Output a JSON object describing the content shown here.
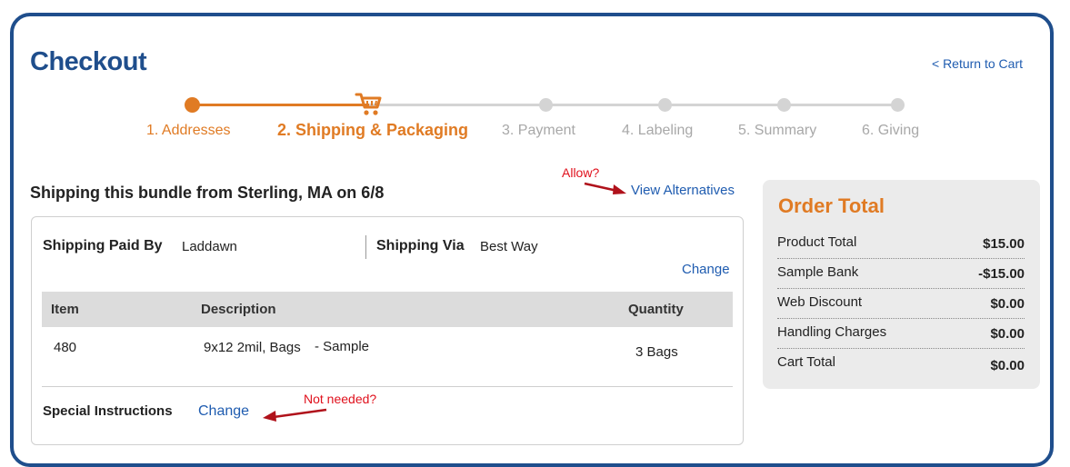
{
  "header": {
    "title": "Checkout",
    "return_link": "< Return to Cart"
  },
  "steps": [
    {
      "label": "1. Addresses",
      "state": "done"
    },
    {
      "label": "2. Shipping & Packaging",
      "state": "active"
    },
    {
      "label": "3. Payment",
      "state": "pending"
    },
    {
      "label": "4. Labeling",
      "state": "pending"
    },
    {
      "label": "5. Summary",
      "state": "pending"
    },
    {
      "label": "6. Giving",
      "state": "pending"
    }
  ],
  "shipping": {
    "heading": "Shipping this bundle from Sterling, MA on 6/8",
    "view_alternatives": "View Alternatives",
    "paid_by_label": "Shipping Paid By",
    "paid_by_value": "Laddawn",
    "via_label": "Shipping Via",
    "via_value": "Best Way",
    "change_label": "Change",
    "table": {
      "headers": [
        "Item",
        "Description",
        "Quantity"
      ],
      "rows": [
        {
          "item": "480",
          "description": "9x12 2mil, Bags",
          "note": "- Sample",
          "quantity": "3 Bags"
        }
      ]
    },
    "special_instructions_label": "Special Instructions",
    "special_change_label": "Change"
  },
  "annotations": {
    "allow": "Allow?",
    "not_needed": "Not needed?"
  },
  "order_total": {
    "title": "Order Total",
    "rows": [
      {
        "label": "Product Total",
        "value": "$15.00"
      },
      {
        "label": "Sample Bank",
        "value": "-$15.00"
      },
      {
        "label": "Web Discount",
        "value": "$0.00"
      },
      {
        "label": "Handling Charges",
        "value": "$0.00"
      },
      {
        "label": "Cart Total",
        "value": "$0.00"
      }
    ]
  },
  "colors": {
    "brand_blue": "#1f4e8c",
    "accent_orange": "#e07b24",
    "link_blue": "#1f5cb0",
    "annotation_red": "#e0101c"
  },
  "icons": {
    "active_step": "shopping-cart-icon"
  }
}
